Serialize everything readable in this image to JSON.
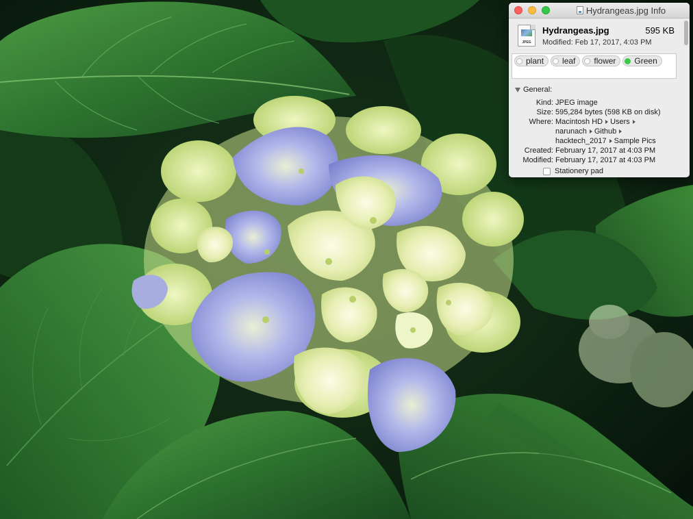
{
  "window": {
    "title": "Hydrangeas.jpg Info"
  },
  "file": {
    "name": "Hydrangeas.jpg",
    "size": "595 KB",
    "modified": "Modified: Feb 17, 2017, 4:03 PM",
    "icon_label": "JPEG"
  },
  "tags": [
    {
      "label": "plant",
      "color": "#ffffff"
    },
    {
      "label": "leaf",
      "color": "#ffffff"
    },
    {
      "label": "flower",
      "color": "#ffffff"
    },
    {
      "label": "Green",
      "color": "#3fc84c"
    }
  ],
  "general": {
    "section_label": "General:",
    "kind_label": "Kind:",
    "kind_value": "JPEG image",
    "size_label": "Size:",
    "size_value": "595,284 bytes (598 KB on disk)",
    "where_label": "Where:",
    "where_path": [
      "Macintosh HD",
      "Users",
      "narunach",
      "Github",
      "hacktech_2017",
      "Sample Pics"
    ],
    "created_label": "Created:",
    "created_value": "February 17, 2017 at 4:03 PM",
    "modified_label": "Modified:",
    "modified_value": "February 17, 2017 at 4:03 PM",
    "stationery_label": "Stationery pad"
  },
  "colors": {
    "leaf_dark": "#1f5a25",
    "leaf_light": "#3f8d3a",
    "petal_blue": "#8e96d8",
    "petal_cream": "#eef3c0",
    "tag_green": "#3fc84c"
  }
}
